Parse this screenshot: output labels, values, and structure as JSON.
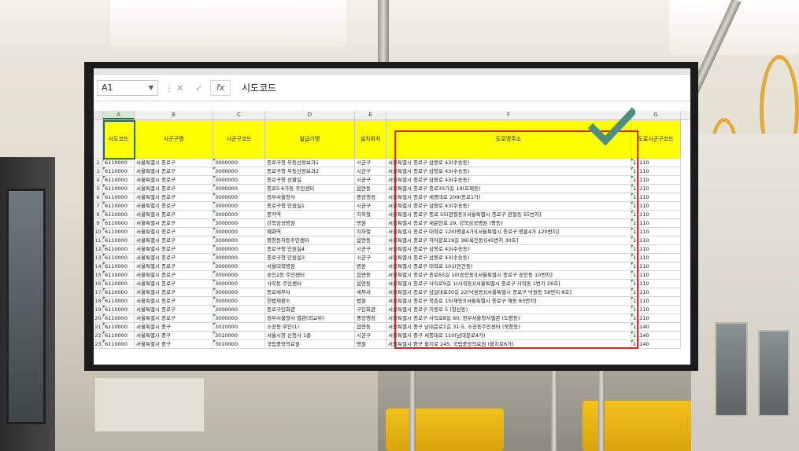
{
  "app": {
    "name_box": "A1",
    "formula_value": "시도코드",
    "fx_label": "fx"
  },
  "columns": [
    {
      "letter": "A",
      "header": "시도코드"
    },
    {
      "letter": "B",
      "header": "시군구명"
    },
    {
      "letter": "C",
      "header": "시군구코드"
    },
    {
      "letter": "D",
      "header": "발급기명"
    },
    {
      "letter": "E",
      "header": "설치위치"
    },
    {
      "letter": "F",
      "header": "도로명주소"
    },
    {
      "letter": "G",
      "header": "도로시군구코드"
    }
  ],
  "header_row_number": "1",
  "rows": [
    {
      "n": "2",
      "a": "6110000",
      "b": "서울특별시 종로구",
      "c": "3000000",
      "d": "종로구청 부동산정보과1",
      "e": "시군구",
      "f": "서울특별시 종로구 삼봉로 43(수송동)",
      "g": "11110"
    },
    {
      "n": "3",
      "a": "6110000",
      "b": "서울특별시 종로구",
      "c": "3000000",
      "d": "종로구청 부동산정보과2",
      "e": "시군구",
      "f": "서울특별시 종로구 삼봉로 43(수송동)",
      "g": "11110"
    },
    {
      "n": "4",
      "a": "6110000",
      "b": "서울특별시 종로구",
      "c": "3000000",
      "d": "종로구청 상황실",
      "e": "시군구",
      "f": "서울특별시 종로구 삼봉로 43(수송동)",
      "g": "11110"
    },
    {
      "n": "5",
      "a": "6110000",
      "b": "서울특별시 종로구",
      "c": "3000000",
      "d": "종로5·6가동 주민센터",
      "e": "읍면동",
      "f": "서울특별시 종로구 종로35가길 19(효제동)",
      "g": "11110"
    },
    {
      "n": "6",
      "a": "6110000",
      "b": "서울특별시 종로구",
      "c": "3000000",
      "d": "정부서울청사",
      "e": "중앙행정",
      "f": "서울특별시 종로구 세종대로 209(종로1가)",
      "g": "11110"
    },
    {
      "n": "7",
      "a": "6110000",
      "b": "서울특별시 종로구",
      "c": "3000000",
      "d": "종로구청 민원실1",
      "e": "시군구",
      "f": "서울특별시 종로구 삼봉로 43(수송동)",
      "g": "11110"
    },
    {
      "n": "8",
      "a": "6110000",
      "b": "서울특별시 종로구",
      "c": "3000000",
      "d": "종각역",
      "e": "지하철",
      "f": "서울특별시 종로구 종로 55(관철동)[서울특별시 종로구 관철동 55번지]",
      "g": "11110"
    },
    {
      "n": "9",
      "a": "6110000",
      "b": "서울특별시 종로구",
      "c": "3000000",
      "d": "강북삼성병원",
      "e": "병원",
      "f": "서울특별시 종로구 새문안로 29, 강북삼성병원 (평동)",
      "g": "11110"
    },
    {
      "n": "10",
      "a": "6110000",
      "b": "서울특별시 종로구",
      "c": "3000000",
      "d": "혜화역",
      "e": "지하철",
      "f": "서울특별시 종로구 대학로 120(명륜4가)[서울특별시 종로구 명륜4가 120번지]",
      "g": "11110"
    },
    {
      "n": "11",
      "a": "6110000",
      "b": "서울특별시 종로구",
      "c": "3000000",
      "d": "평창동자동주민센터",
      "e": "읍면동",
      "f": "서울특별시 종로구 자하문로19길 36(옥인동)[45번지 30호]",
      "g": "11110"
    },
    {
      "n": "12",
      "a": "6110000",
      "b": "서울특별시 종로구",
      "c": "3000000",
      "d": "종로구청 민원실4",
      "e": "시군구",
      "f": "서울특별시 종로구 삼봉로 43(수송동)",
      "g": "11110"
    },
    {
      "n": "13",
      "a": "6110000",
      "b": "서울특별시 종로구",
      "c": "3000000",
      "d": "종로구청 민원실3",
      "e": "시군구",
      "f": "서울특별시 종로구 삼봉로 43(수송동)",
      "g": "11110"
    },
    {
      "n": "14",
      "a": "6110000",
      "b": "서울특별시 종로구",
      "c": "3000000",
      "d": "서울대학병원",
      "e": "병원",
      "f": "서울특별시 종로구 대학로 101(연건동)",
      "g": "11110"
    },
    {
      "n": "15",
      "a": "6110000",
      "b": "서울특별시 종로구",
      "c": "3000000",
      "d": "숭인2동 주민센터",
      "e": "읍면동",
      "f": "서울특별시 종로구 종로65길 10(숭인동)[서울특별시 종로구 숭인동 10번지]",
      "g": "11110"
    },
    {
      "n": "16",
      "a": "6110000",
      "b": "서울특별시 종로구",
      "c": "3000000",
      "d": "사직동 주민센터",
      "e": "읍면동",
      "f": "서울특별시 종로구 사직로9길 1(사직동)[서울특별시 종로구 사직동 1번지 28호]",
      "g": "11110"
    },
    {
      "n": "17",
      "a": "6110000",
      "b": "서울특별시 종로구",
      "c": "3000000",
      "d": "종로세무서",
      "e": "세무서",
      "f": "서울특별시 종로구 삼일대로30길 22(낙원동)[서울특별시 종로구 낙원동 58번지 8호]",
      "g": "11110"
    },
    {
      "n": "18",
      "a": "6110000",
      "b": "서울특별시 종로구",
      "c": "3000000",
      "d": "헌법재판소",
      "e": "법원",
      "f": "서울특별시 종로구 북촌로 15(재동)[서울특별시 종로구 재동 83번지]",
      "g": "11110"
    },
    {
      "n": "19",
      "a": "6110000",
      "b": "서울특별시 종로구",
      "c": "3000000",
      "d": "종로구민회관",
      "e": "구민회관",
      "f": "서울특별시 종로구 지봉로 5 (창신동)",
      "g": "11110"
    },
    {
      "n": "20",
      "a": "6110000",
      "b": "서울특별시 종로구",
      "c": "3000000",
      "d": "정부서울청사 별관(외교부)",
      "e": "중앙행정",
      "f": "서울특별시 종로구 사직로8길 60, 정부서울청사별관 (도렴동)",
      "g": "11110"
    },
    {
      "n": "21",
      "a": "6110000",
      "b": "서울특별시 중구",
      "c": "3010000",
      "d": "소공동·무인(1)",
      "e": "읍면동",
      "f": "서울특별시 중구 남대문로1길 31-5, 소공동주민센터 (북창동)",
      "g": "11140"
    },
    {
      "n": "22",
      "a": "6110000",
      "b": "서울특별시 중구",
      "c": "3010000",
      "d": "서울시청 신청사 1층",
      "e": "시군구",
      "f": "서울특별시 중구 세종대로 110(남대문로4가)",
      "g": "11140"
    },
    {
      "n": "23",
      "a": "6110000",
      "b": "서울특별시 중구",
      "c": "3010000",
      "d": "국립중앙의료원",
      "e": "병원",
      "f": "서울특별시 중구 을지로 245, 국립중앙의료원 (을지로6가)",
      "g": "11140"
    }
  ],
  "colors": {
    "header_fill": "#ffff00",
    "highlight_box": "#d92424",
    "check_mark": "#4f8f82",
    "selection": "#217346"
  }
}
